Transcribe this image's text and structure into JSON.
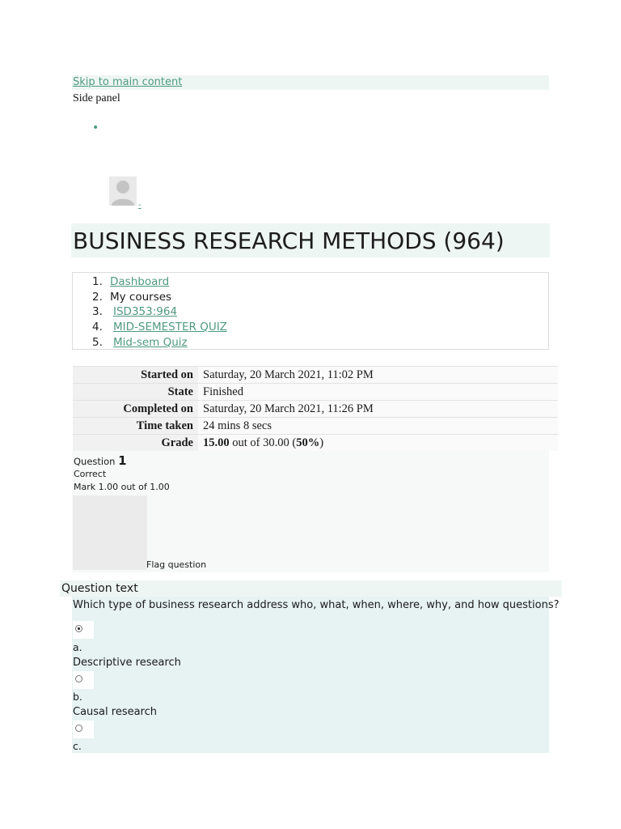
{
  "header": {
    "skip_link": "Skip to main content",
    "side_panel": "Side panel",
    "nav_bullet": "•"
  },
  "user": {
    "avatar_dash": "-"
  },
  "course": {
    "title": "BUSINESS RESEARCH METHODS (964)"
  },
  "breadcrumb": [
    {
      "num": "1.",
      "label": "Dashboard"
    },
    {
      "num": "2.",
      "label": "My courses"
    },
    {
      "num": "3.",
      "label": "ISD353:964"
    },
    {
      "num": "4.",
      "label": "MID-SEMESTER QUIZ"
    },
    {
      "num": "5.",
      "label": "Mid-sem Quiz"
    }
  ],
  "summary": {
    "started_label": "Started on",
    "started_value": "Saturday, 20 March 2021, 11:02 PM",
    "state_label": "State",
    "state_value": "Finished",
    "completed_label": "Completed on",
    "completed_value": "Saturday, 20 March 2021, 11:26 PM",
    "time_label": "Time taken",
    "time_value": "24 mins 8 secs",
    "grade_label": "Grade",
    "grade_score": "15.00",
    "grade_mid": " out of 30.00 (",
    "grade_pct": "50%",
    "grade_end": ")"
  },
  "question": {
    "label": "Question ",
    "number": "1",
    "state": "Correct",
    "mark": "Mark 1.00 out of 1.00",
    "flag": "Flag question",
    "text_header": "Question text",
    "text": "Which type of business research address who, what, when, where, why, and how questions?",
    "options": [
      {
        "letter": "a.",
        "text": "Descriptive research",
        "checked": true
      },
      {
        "letter": "b.",
        "text": "Causal research",
        "checked": false
      },
      {
        "letter": "c.",
        "text": "",
        "checked": false
      }
    ]
  }
}
